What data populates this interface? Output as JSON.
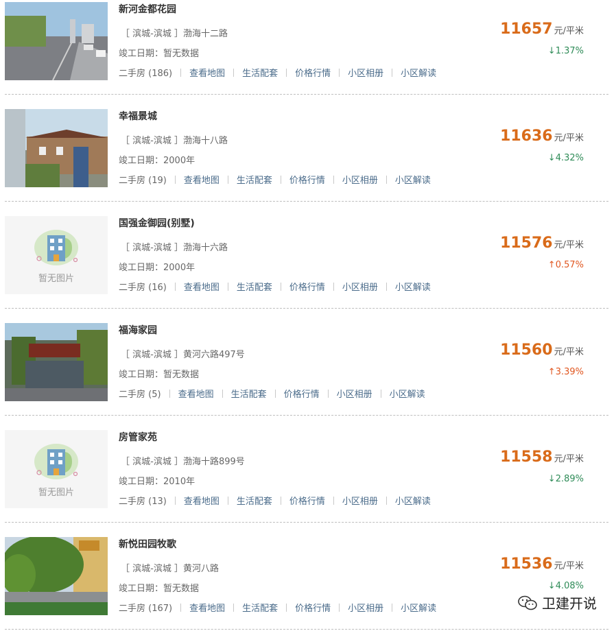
{
  "listings": [
    {
      "name": "新河金都花园",
      "address": "［ 滨城-滨城 ］渤海十二路",
      "completion": "竣工日期：暂无数据",
      "price": "11657",
      "unit": "元/平米",
      "change": "↓1.37%",
      "trend": "down",
      "links": [
        "二手房 (186)",
        "查看地图",
        "生活配套",
        "价格行情",
        "小区相册",
        "小区解读"
      ],
      "image": "street-photo"
    },
    {
      "name": "幸福景城",
      "address": "［ 滨城-滨城 ］渤海十八路",
      "completion": "竣工日期：2000年",
      "price": "11636",
      "unit": "元/平米",
      "change": "↓4.32%",
      "trend": "down",
      "links": [
        "二手房 (19)",
        "查看地图",
        "生活配套",
        "价格行情",
        "小区相册",
        "小区解读"
      ],
      "image": "gate-photo"
    },
    {
      "name": "国强金御园(别墅)",
      "address": "［ 滨城-滨城 ］渤海十六路",
      "completion": "竣工日期：2000年",
      "price": "11576",
      "unit": "元/平米",
      "change": "↑0.57%",
      "trend": "up",
      "links": [
        "二手房 (16)",
        "查看地图",
        "生活配套",
        "价格行情",
        "小区相册",
        "小区解读"
      ],
      "image": "no-image",
      "image_label": "暂无图片"
    },
    {
      "name": "福海家园",
      "address": "［ 滨城-滨城 ］黄河六路497号",
      "completion": "竣工日期：暂无数据",
      "price": "11560",
      "unit": "元/平米",
      "change": "↑3.39%",
      "trend": "up",
      "links": [
        "二手房 (5)",
        "查看地图",
        "生活配套",
        "价格行情",
        "小区相册",
        "小区解读"
      ],
      "image": "shop-photo"
    },
    {
      "name": "房管家苑",
      "address": "［ 滨城-滨城 ］渤海十路899号",
      "completion": "竣工日期：2010年",
      "price": "11558",
      "unit": "元/平米",
      "change": "↓2.89%",
      "trend": "down",
      "links": [
        "二手房 (13)",
        "查看地图",
        "生活配套",
        "价格行情",
        "小区相册",
        "小区解读"
      ],
      "image": "no-image",
      "image_label": "暂无图片"
    },
    {
      "name": "新悦田园牧歌",
      "address": "［ 滨城-滨城 ］黄河八路",
      "completion": "竣工日期：暂无数据",
      "price": "11536",
      "unit": "元/平米",
      "change": "↓4.08%",
      "trend": "down",
      "links": [
        "二手房 (167)",
        "查看地图",
        "生活配套",
        "价格行情",
        "小区相册",
        "小区解读"
      ],
      "image": "tree-photo"
    }
  ],
  "watermark": {
    "text": "卫建开说",
    "icon": "wechat-icon"
  },
  "colors": {
    "price": "#d96b1a",
    "down": "#2e8b57",
    "up": "#e0561f",
    "link": "#4a6b8a"
  }
}
